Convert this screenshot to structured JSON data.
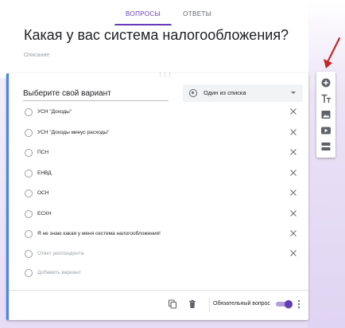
{
  "tabs": [
    {
      "label": "ВОПРОСЫ",
      "active": true
    },
    {
      "label": "ОТВЕТЫ",
      "active": false
    }
  ],
  "form": {
    "title": "Какая у вас система налогообложения?",
    "description_placeholder": "Описание"
  },
  "question": {
    "title": "Выберите свой вариант",
    "type_label": "Один из списка",
    "options": [
      {
        "label": "УСН \"Доходы\""
      },
      {
        "label": "УСН \"Доходы минус расходы\""
      },
      {
        "label": "ПСН"
      },
      {
        "label": "ЕНВД"
      },
      {
        "label": "ОСН"
      },
      {
        "label": "ЕСХН"
      },
      {
        "label": "Я не знаю какая у меня сестема налогообложения!"
      }
    ],
    "other_option_placeholder": "Ответ респондента",
    "add_option_label": "Добавить вариант",
    "required_label": "Обязательный вопрос",
    "required_on": true
  },
  "colors": {
    "accent": "#673ab7",
    "card_border": "#4285f4",
    "annotation_arrow": "#c62828"
  },
  "icons": {
    "side_toolbar": [
      "add-question-icon",
      "add-title-icon",
      "add-image-icon",
      "add-video-icon",
      "add-section-icon"
    ],
    "footer": [
      "duplicate-icon",
      "delete-icon",
      "more-vert-icon"
    ]
  }
}
